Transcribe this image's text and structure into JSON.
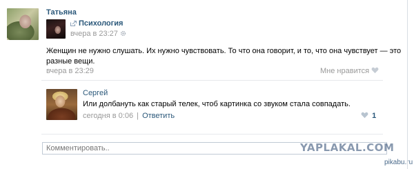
{
  "post": {
    "author": "Татьяна",
    "repost_group": "Психология",
    "repost_time": "вчера в 23:27",
    "text_line1": "Женщин не нужно слушать. Их нужно чувствовать. То что она говорит, и то, что она чувствует — это",
    "text_line2": "разные вещи.",
    "time": "вчера в 23:29",
    "like_label": "Мне нравится"
  },
  "comment": {
    "author": "Сергей",
    "text": "Или долбануть как старый телек, чтоб картинка со звуком стала совпадать.",
    "time": "сегодня в 0:06",
    "separator": "|",
    "reply_label": "Ответить",
    "like_count": "1"
  },
  "composer": {
    "placeholder": "Комментировать.."
  },
  "watermark": "YAPLAKAL.COM",
  "credit": "pikabu.ru",
  "icons": [
    "share-icon",
    "gear-icon",
    "heart-icon"
  ],
  "colors": {
    "link": "#2b587a",
    "muted": "#999999",
    "divider": "#e7e8ec"
  }
}
